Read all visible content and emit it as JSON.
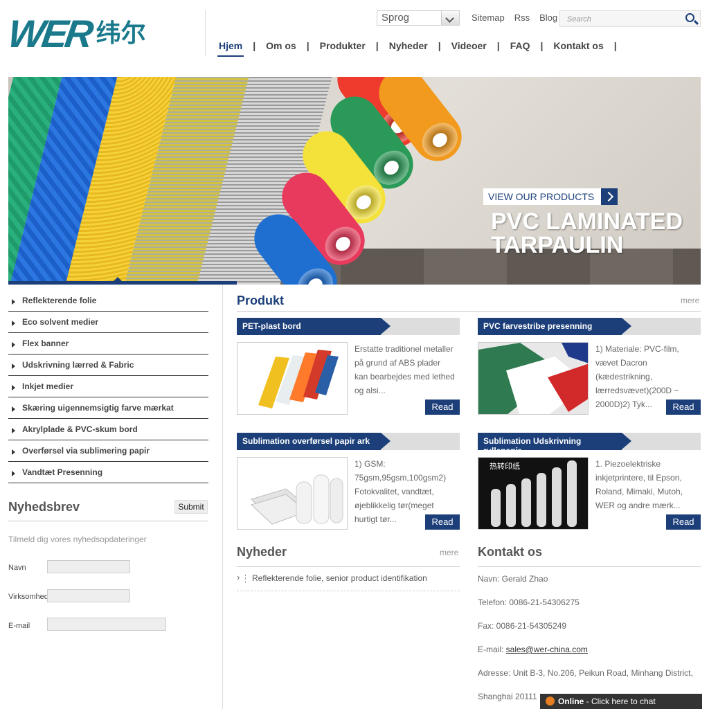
{
  "logo": {
    "brand": "WER",
    "chinese": "纬尔"
  },
  "top": {
    "language": "Sprog",
    "links": [
      "Sitemap",
      "Rss",
      "Blog"
    ],
    "search_placeholder": "Search"
  },
  "nav": [
    "Hjem",
    "Om os",
    "Produkter",
    "Nyheder",
    "Videoer",
    "FAQ",
    "Kontakt os"
  ],
  "nav_sep": "|",
  "banner": {
    "title_line1": "PVC LAMINATED",
    "title_line2": "TARPAULIN",
    "button": "VIEW OUR PRODUCTS"
  },
  "categories": [
    "Reflekterende folie",
    "Eco solvent medier",
    "Flex banner",
    "Udskrivning lærred & Fabric",
    "Inkjet medier",
    "Skæring uigennemsigtig farve mærkat",
    "Akrylplade & PVC-skum bord",
    "Overførsel via sublimering papir",
    "Vandtæt Presenning"
  ],
  "newsletter": {
    "title": "Nyhedsbrev",
    "submit": "Submit",
    "desc": "Tilmeld dig vores nyhedsopdateringer",
    "fields": [
      "Navn",
      "Virksomhed",
      "E-mail"
    ]
  },
  "produkt": {
    "title": "Produkt",
    "more": "mere",
    "read": "Read",
    "items": [
      {
        "title": "PET-plast bord",
        "text": "Erstatte traditionel metaller på grund af ABS plader kan bearbejdes med lethed og alsi..."
      },
      {
        "title": "PVC farvestribe presenning",
        "text": "1) Materiale: PVC-film, vævet Dacron (kædestrikning, lærredsvævet)(200D ~ 2000D)2) Tyk..."
      },
      {
        "title": "Sublimation overførsel papir ark",
        "text": "1) GSM: 75gsm,95gsm,100gsm2) Fotokvalitet, vandtæt, øjeblikkelig tør(meget hurtigt tør..."
      },
      {
        "title": "Sublimation Udskrivning rullepapir",
        "text": "1. Piezoelektriske inkjetprintere, til Epson, Roland, Mimaki, Mutoh, WER og andre mærk..."
      }
    ],
    "thumb4_label": "热转印纸"
  },
  "nyheder": {
    "title": "Nyheder",
    "more": "mere",
    "items": [
      "Reflekterende folie, senior product identifikation"
    ]
  },
  "kontakt": {
    "title": "Kontakt os",
    "name": "Navn: Gerald Zhao",
    "phone": "Telefon: 0086-21-54306275",
    "fax": "Fax: 0086-21-54305249",
    "email_label": "E-mail: ",
    "email": "sales@wer-china.com",
    "address": "Adresse: Unit B-3, No.206, Peikun Road, Minhang District,",
    "address2": "Shanghai 20111"
  },
  "chat": {
    "status": "Online",
    "text": " - Click here to chat"
  },
  "colors": {
    "brand": "#1a7a8c",
    "navy": "#1c3f7a"
  }
}
